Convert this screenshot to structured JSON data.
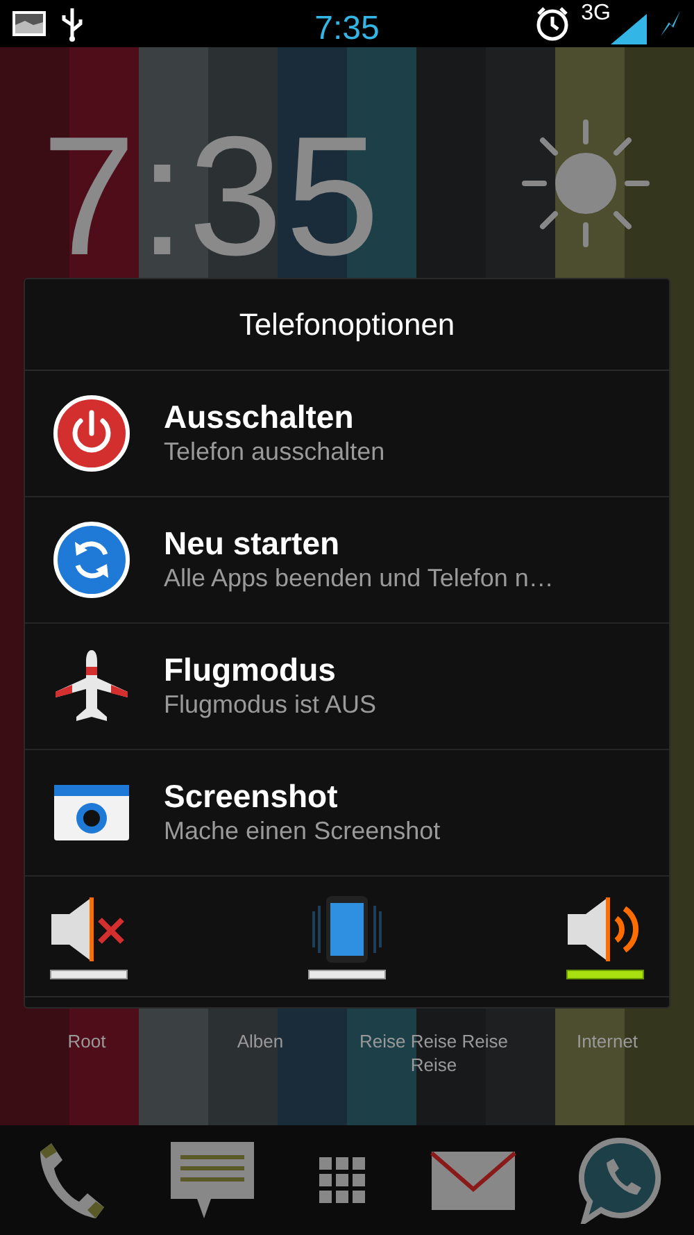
{
  "status_bar": {
    "time": "7:35",
    "network": "3G"
  },
  "clock_widget": {
    "time": "7:35"
  },
  "dialog": {
    "title": "Telefonoptionen",
    "items": [
      {
        "kind": "power",
        "title": "Ausschalten",
        "subtitle": "Telefon ausschalten"
      },
      {
        "kind": "restart",
        "title": "Neu starten",
        "subtitle": "Alle Apps beenden und Telefon n…"
      },
      {
        "kind": "airplane",
        "title": "Flugmodus",
        "subtitle": "Flugmodus ist AUS"
      },
      {
        "kind": "screenshot",
        "title": "Screenshot",
        "subtitle": "Mache einen Screenshot"
      }
    ],
    "sound_modes": [
      {
        "kind": "mute",
        "selected": false
      },
      {
        "kind": "vibrate",
        "selected": false
      },
      {
        "kind": "sound",
        "selected": true
      }
    ]
  },
  "home_labels": [
    "Root",
    "Alben",
    "Reise Reise Reise Reise",
    "Internet"
  ]
}
